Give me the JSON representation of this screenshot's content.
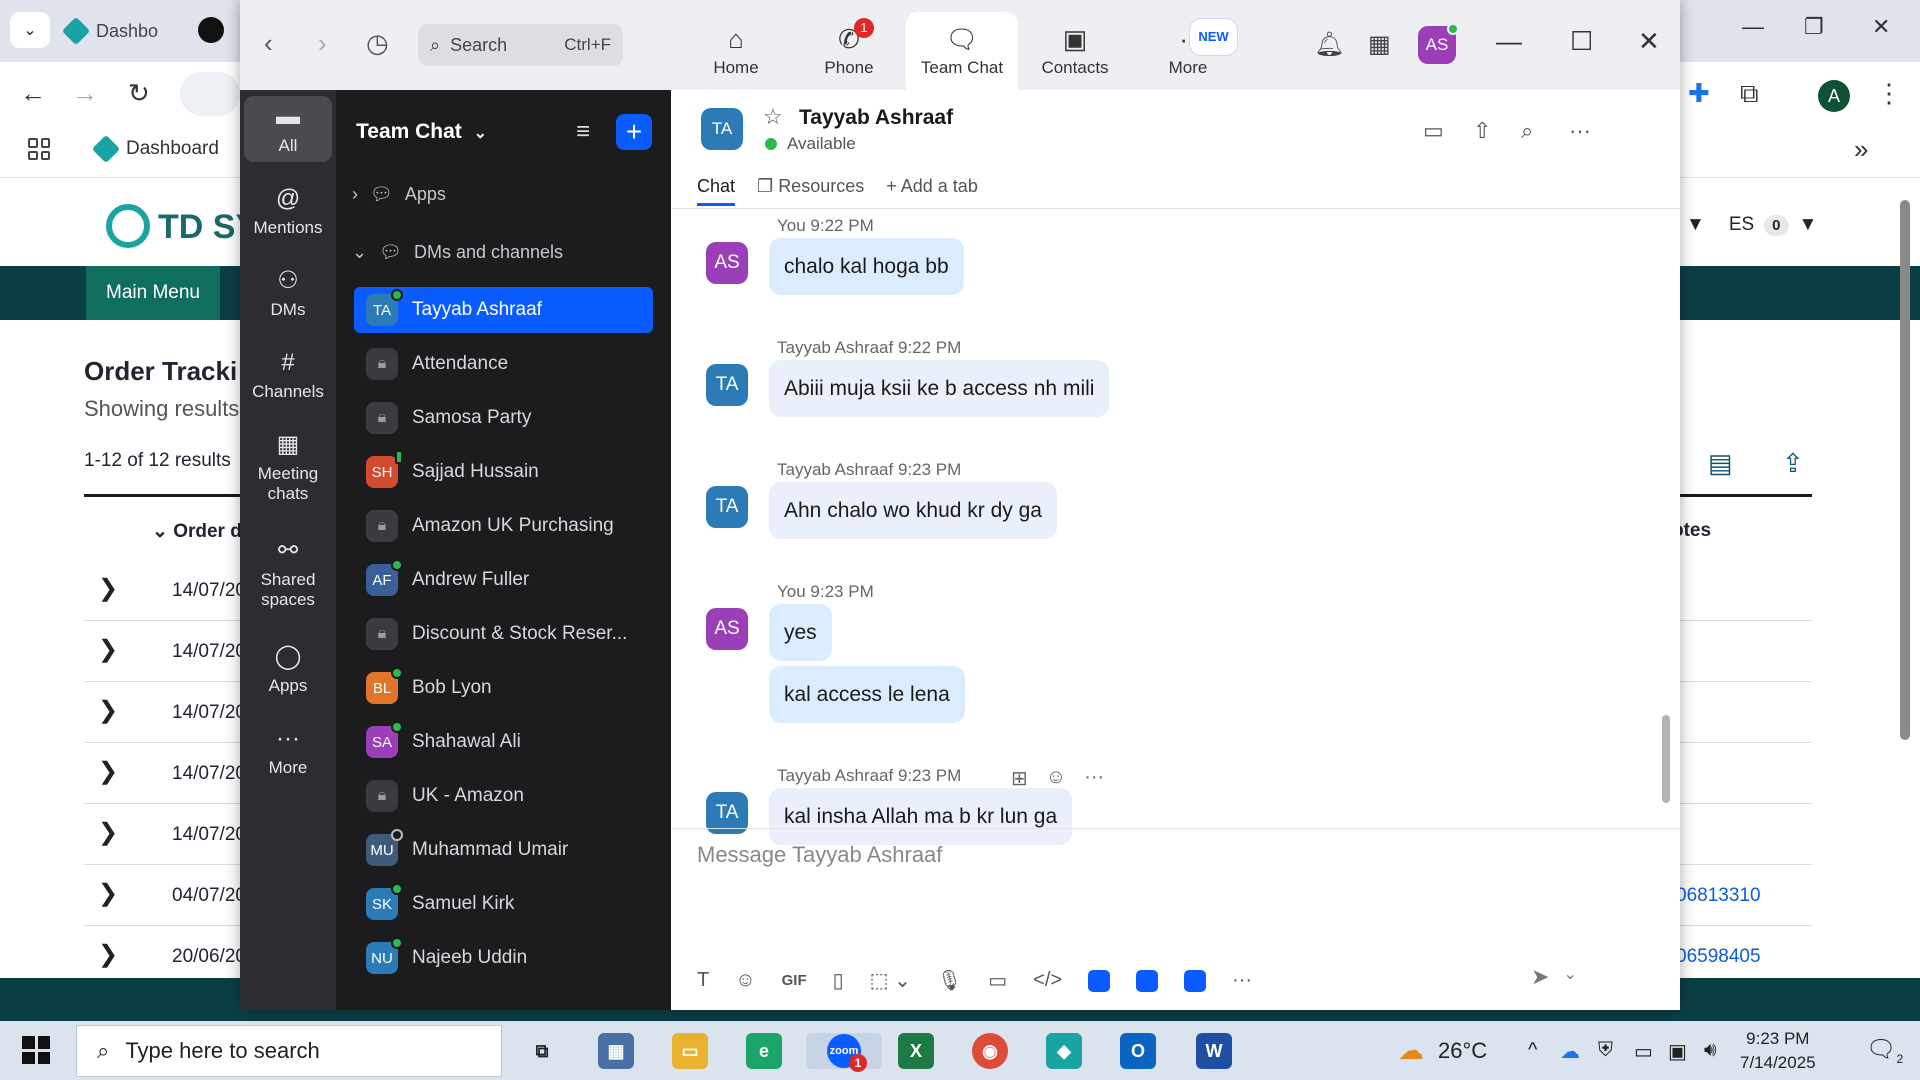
{
  "browser": {
    "tab_title": "Dashbo",
    "bookmark": "Dashboard",
    "page": {
      "logo_text": "TD SY",
      "user_initials": "ES",
      "user_count": "0",
      "main_menu": "Main Menu",
      "title": "Order Tracki",
      "showing": "Showing results",
      "count": "1-12 of 12 results",
      "col_order_date": "Order d",
      "col_notes": "otes",
      "rows": [
        {
          "date": "14/07/20",
          "num": ""
        },
        {
          "date": "14/07/20",
          "num": ""
        },
        {
          "date": "14/07/20",
          "num": ""
        },
        {
          "date": "14/07/20",
          "num": ""
        },
        {
          "date": "14/07/20",
          "num": ""
        },
        {
          "date": "04/07/20",
          "num": "06813310"
        },
        {
          "date": "20/06/20",
          "num": "06598405"
        }
      ]
    },
    "profile_initial": "A"
  },
  "zoom": {
    "search_placeholder": "Search",
    "search_shortcut": "Ctrl+F",
    "nav": [
      {
        "label": "Home",
        "icon": "home-icon"
      },
      {
        "label": "Phone",
        "icon": "phone-icon",
        "badge": "1"
      },
      {
        "label": "Team Chat",
        "icon": "chat-icon"
      },
      {
        "label": "Contacts",
        "icon": "contacts-icon"
      },
      {
        "label": "More",
        "icon": "more-icon",
        "badge": "NEW"
      }
    ],
    "avatar_initials": "AS",
    "rail": [
      {
        "label": "All"
      },
      {
        "label": "Mentions"
      },
      {
        "label": "DMs"
      },
      {
        "label": "Channels"
      },
      {
        "label": "Meeting chats"
      },
      {
        "label": "Shared spaces"
      },
      {
        "label": "Apps"
      },
      {
        "label": "More"
      }
    ],
    "list_title": "Team Chat",
    "section_apps": "Apps",
    "section_dms": "DMs and channels",
    "channels": [
      {
        "name": "Tayyab Ashraaf",
        "initials": "TA",
        "color": "#2c7bb6",
        "presence": "online"
      },
      {
        "name": "Attendance",
        "initials": "",
        "color": "",
        "presence": "locked"
      },
      {
        "name": "Samosa Party",
        "initials": "",
        "color": "",
        "presence": "locked"
      },
      {
        "name": "Sajjad Hussain",
        "initials": "SH",
        "color": "#d24a2f",
        "presence": "mobile"
      },
      {
        "name": "Amazon UK Purchasing",
        "initials": "",
        "color": "",
        "presence": "locked"
      },
      {
        "name": "Andrew Fuller",
        "initials": "AF",
        "color": "#3a5f9b",
        "presence": "online"
      },
      {
        "name": "Discount & Stock Reser...",
        "initials": "",
        "color": "",
        "presence": "locked"
      },
      {
        "name": "Bob Lyon",
        "initials": "BL",
        "color": "#e0762a",
        "presence": "online"
      },
      {
        "name": "Shahawal Ali",
        "initials": "SA",
        "color": "#9b3fb8",
        "presence": "online"
      },
      {
        "name": "UK - Amazon",
        "initials": "",
        "color": "",
        "presence": "locked"
      },
      {
        "name": "Muhammad Umair",
        "initials": "MU",
        "color": "#3e5c7a",
        "presence": "away"
      },
      {
        "name": "Samuel Kirk",
        "initials": "SK",
        "color": "#2c7bb6",
        "presence": "online"
      },
      {
        "name": "Najeeb Uddin",
        "initials": "NU",
        "color": "#2c7bb6",
        "presence": "online"
      }
    ],
    "chat": {
      "contact_initials": "TA",
      "contact_name": "Tayyab Ashraaf",
      "status": "Available",
      "tabs": [
        "Chat",
        "Resources",
        "Add a tab"
      ],
      "messages": [
        {
          "sender": "You",
          "time": "9:22 PM",
          "initials": "AS",
          "color": "#9b3fb8",
          "mine": true,
          "lines": [
            "chalo kal hoga bb"
          ]
        },
        {
          "sender": "Tayyab Ashraaf",
          "time": "9:22 PM",
          "initials": "TA",
          "color": "#2c7bb6",
          "mine": false,
          "lines": [
            "Abiii muja ksii ke b access nh mili"
          ]
        },
        {
          "sender": "Tayyab Ashraaf",
          "time": "9:23 PM",
          "initials": "TA",
          "color": "#2c7bb6",
          "mine": false,
          "lines": [
            "Ahn chalo wo khud kr dy ga"
          ]
        },
        {
          "sender": "You",
          "time": "9:23 PM",
          "initials": "AS",
          "color": "#9b3fb8",
          "mine": true,
          "lines": [
            "yes",
            "kal access le lena"
          ]
        },
        {
          "sender": "Tayyab Ashraaf",
          "time": "9:23 PM",
          "initials": "TA",
          "color": "#2c7bb6",
          "mine": false,
          "lines": [
            "kal insha Allah ma b kr lun ga"
          ]
        }
      ],
      "compose_placeholder": "Message Tayyab Ashraaf",
      "toolbar_gif": "GIF"
    }
  },
  "taskbar": {
    "search_placeholder": "Type here to search",
    "temperature": "26°C",
    "time": "9:23 PM",
    "date": "7/14/2025",
    "notifications": "2",
    "zoom_badge": "1"
  }
}
